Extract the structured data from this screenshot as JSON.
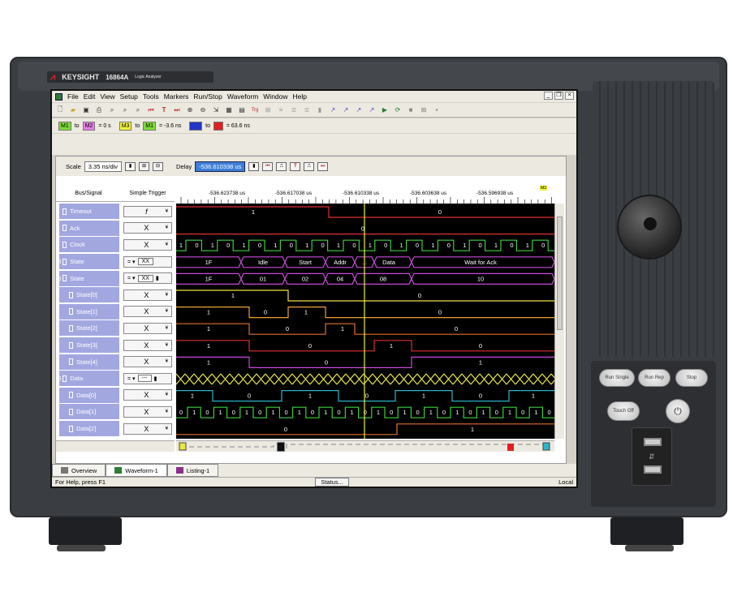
{
  "brand": {
    "name": "KEYSIGHT",
    "model": "16864A",
    "subtitle": "Logic Analyzer"
  },
  "menu": [
    "File",
    "Edit",
    "View",
    "Setup",
    "Tools",
    "Markers",
    "Run/Stop",
    "Waveform",
    "Window",
    "Help"
  ],
  "markers": {
    "m1_m2": "= 0 s",
    "m3_m1": "= -3.6 ns",
    "mx_m2": "= 63.6 ns",
    "m1": "M1",
    "m2": "M2",
    "m3": "M3",
    "to": "to"
  },
  "scale": {
    "label": "Scale",
    "value": "3.35 ns/div",
    "delay_label": "Delay",
    "delay_value": "-536.610338 us"
  },
  "columns": {
    "signal": "Bus/Signal",
    "trigger": "Simple Trigger"
  },
  "time_labels": [
    "-536.623738 us",
    "-536.617038 us",
    "-536.610338 us",
    "-536.603638 us",
    "-536.596938 us"
  ],
  "marker_flag": "M3",
  "signals": [
    {
      "name": "Timeout",
      "trig": "f",
      "trigtype": "edge"
    },
    {
      "name": "Ack",
      "trig": "X",
      "trigtype": "x"
    },
    {
      "name": "Clock",
      "trig": "X",
      "trigtype": "x"
    },
    {
      "name": "State",
      "trig": "XX",
      "trigtype": "bus",
      "prefix": "⊞"
    },
    {
      "name": "State",
      "trig": "XX",
      "trigtype": "bus2",
      "prefix": "⊟"
    },
    {
      "name": "State[0]",
      "trig": "X",
      "trigtype": "x"
    },
    {
      "name": "State[1]",
      "trig": "X",
      "trigtype": "x"
    },
    {
      "name": "State[2]",
      "trig": "X",
      "trigtype": "x"
    },
    {
      "name": "State[3]",
      "trig": "X",
      "trigtype": "x"
    },
    {
      "name": "State[4]",
      "trig": "X",
      "trigtype": "x"
    },
    {
      "name": "Data",
      "trig": "---",
      "trigtype": "bus3",
      "prefix": "⊟"
    },
    {
      "name": "Data[0]",
      "trig": "X",
      "trigtype": "x"
    },
    {
      "name": "Data[1]",
      "trig": "X",
      "trigtype": "x"
    },
    {
      "name": "Data[2]",
      "trig": "X",
      "trigtype": "x"
    }
  ],
  "wave_text": {
    "timeout": [
      "1",
      "0"
    ],
    "ack": [
      "0"
    ],
    "clock": [
      "1",
      "0",
      "1",
      "0",
      "1",
      "0",
      "1",
      "0",
      "1",
      "0",
      "1",
      "0",
      "1",
      "0",
      "1",
      "0",
      "1",
      "0",
      "1",
      "0",
      "1",
      "0",
      "1",
      "0"
    ],
    "state_names": [
      "1F",
      "Idle",
      "Start",
      "Addr",
      "...",
      "Data",
      "Wait for Ack"
    ],
    "state_hex": [
      "1F",
      "01",
      "02",
      "04",
      "08",
      "10"
    ],
    "s0": [
      "1",
      "0"
    ],
    "s1": [
      "1",
      "0",
      "1",
      "0"
    ],
    "s2": [
      "1",
      "0",
      "1",
      "0"
    ],
    "s3": [
      "1",
      "0",
      "1",
      "0"
    ],
    "s4": [
      "1",
      "0",
      "1"
    ],
    "d0": [
      "1",
      "0",
      "1",
      "0",
      "1",
      "0",
      "1"
    ],
    "d1": [
      "0",
      "1",
      "0",
      "1",
      "0",
      "1",
      "0",
      "1",
      "0",
      "1",
      "0",
      "1",
      "0",
      "1",
      "0",
      "1",
      "0",
      "1",
      "0",
      "1",
      "0",
      "1",
      "0",
      "1",
      "0",
      "1",
      "0",
      "1",
      "0"
    ],
    "d2": [
      "0",
      "1"
    ]
  },
  "tabs": [
    "Overview",
    "Waveform-1",
    "Listing-1"
  ],
  "status": {
    "help": "For Help, press F1",
    "button": "Status...",
    "mode": "Local"
  },
  "hw_buttons": {
    "run_single": "Run Single",
    "run_rep": "Run Rep",
    "stop": "Stop",
    "touch_off": "Touch Off"
  }
}
